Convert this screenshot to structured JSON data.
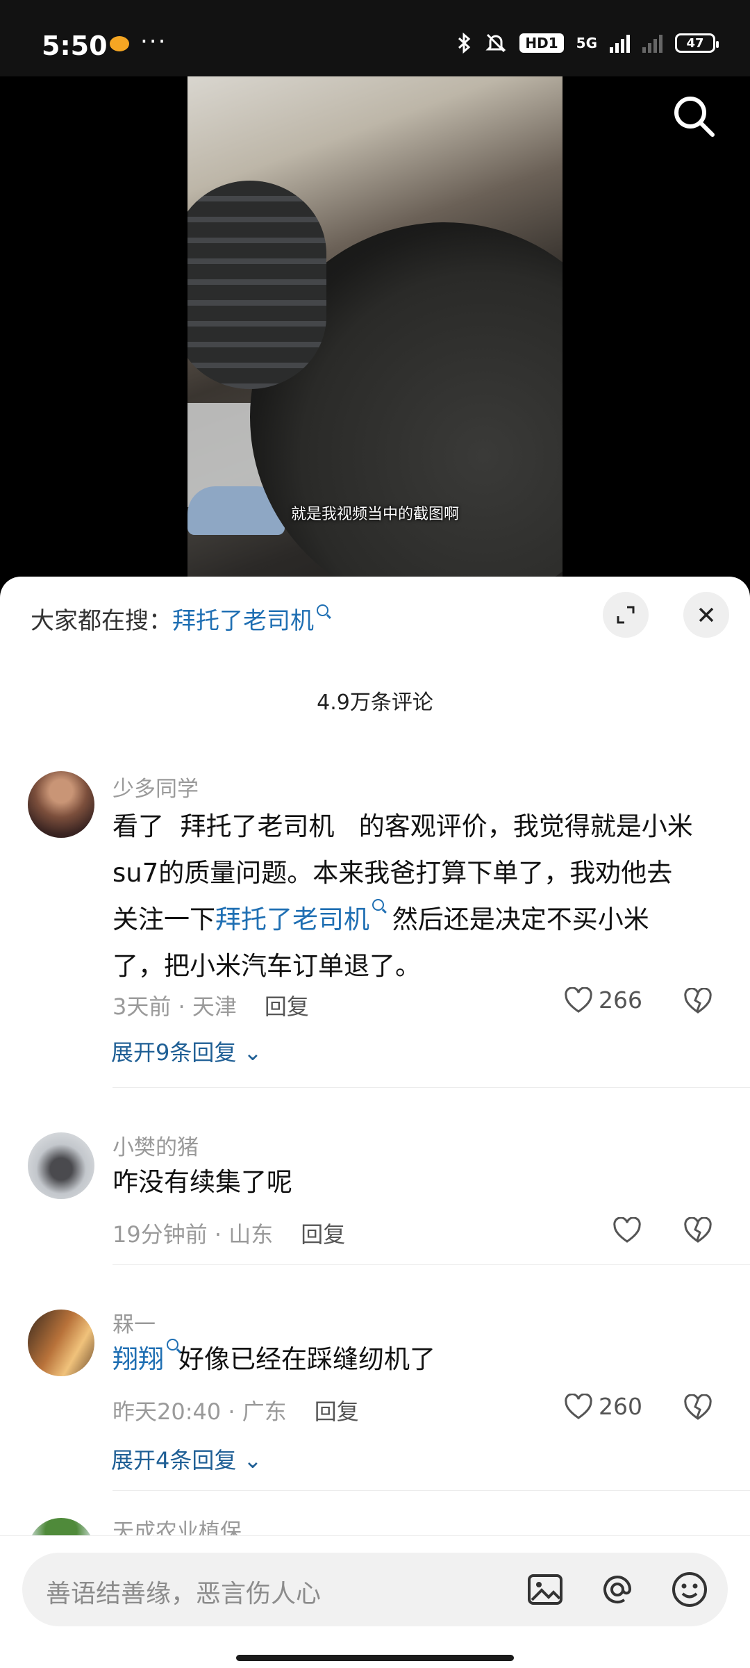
{
  "status": {
    "time": "5:50",
    "hd": "HD1",
    "network": "5G",
    "battery": "47"
  },
  "video": {
    "caption": "就是我视频当中的截图啊"
  },
  "sheet": {
    "hot_search_prefix": "大家都在搜：",
    "hot_search_term": "拜托了老司机",
    "count": "4.9万条评论"
  },
  "comments": [
    {
      "name": "少多同学",
      "text_line1": "看了  拜托了老司机   的客观评价，我觉得就是小米",
      "text_line2": "su7的质量问题。本来我爸打算下单了，我劝他去",
      "text_line3_pre": "关注一下",
      "text_line3_link": "拜托了老司机",
      "text_line3_post": " 然后还是决定不买小米",
      "text_line4": "了，把小米汽车订单退了。",
      "time": "3天前",
      "location": "天津",
      "reply": "回复",
      "likes": "266",
      "expand": "展开9条回复"
    },
    {
      "name": "小樊的猪",
      "text": "咋没有续集了呢",
      "time": "19分钟前",
      "location": "山东",
      "reply": "回复"
    },
    {
      "name": "槑一",
      "link": "翔翔",
      "text": "好像已经在踩缝纫机了",
      "time": "昨天20:40",
      "location": "广东",
      "reply": "回复",
      "likes": "260",
      "expand": "展开4条回复"
    },
    {
      "name": "天成农业植保"
    }
  ],
  "input": {
    "placeholder": "善语结善缘，恶言伤人心"
  }
}
